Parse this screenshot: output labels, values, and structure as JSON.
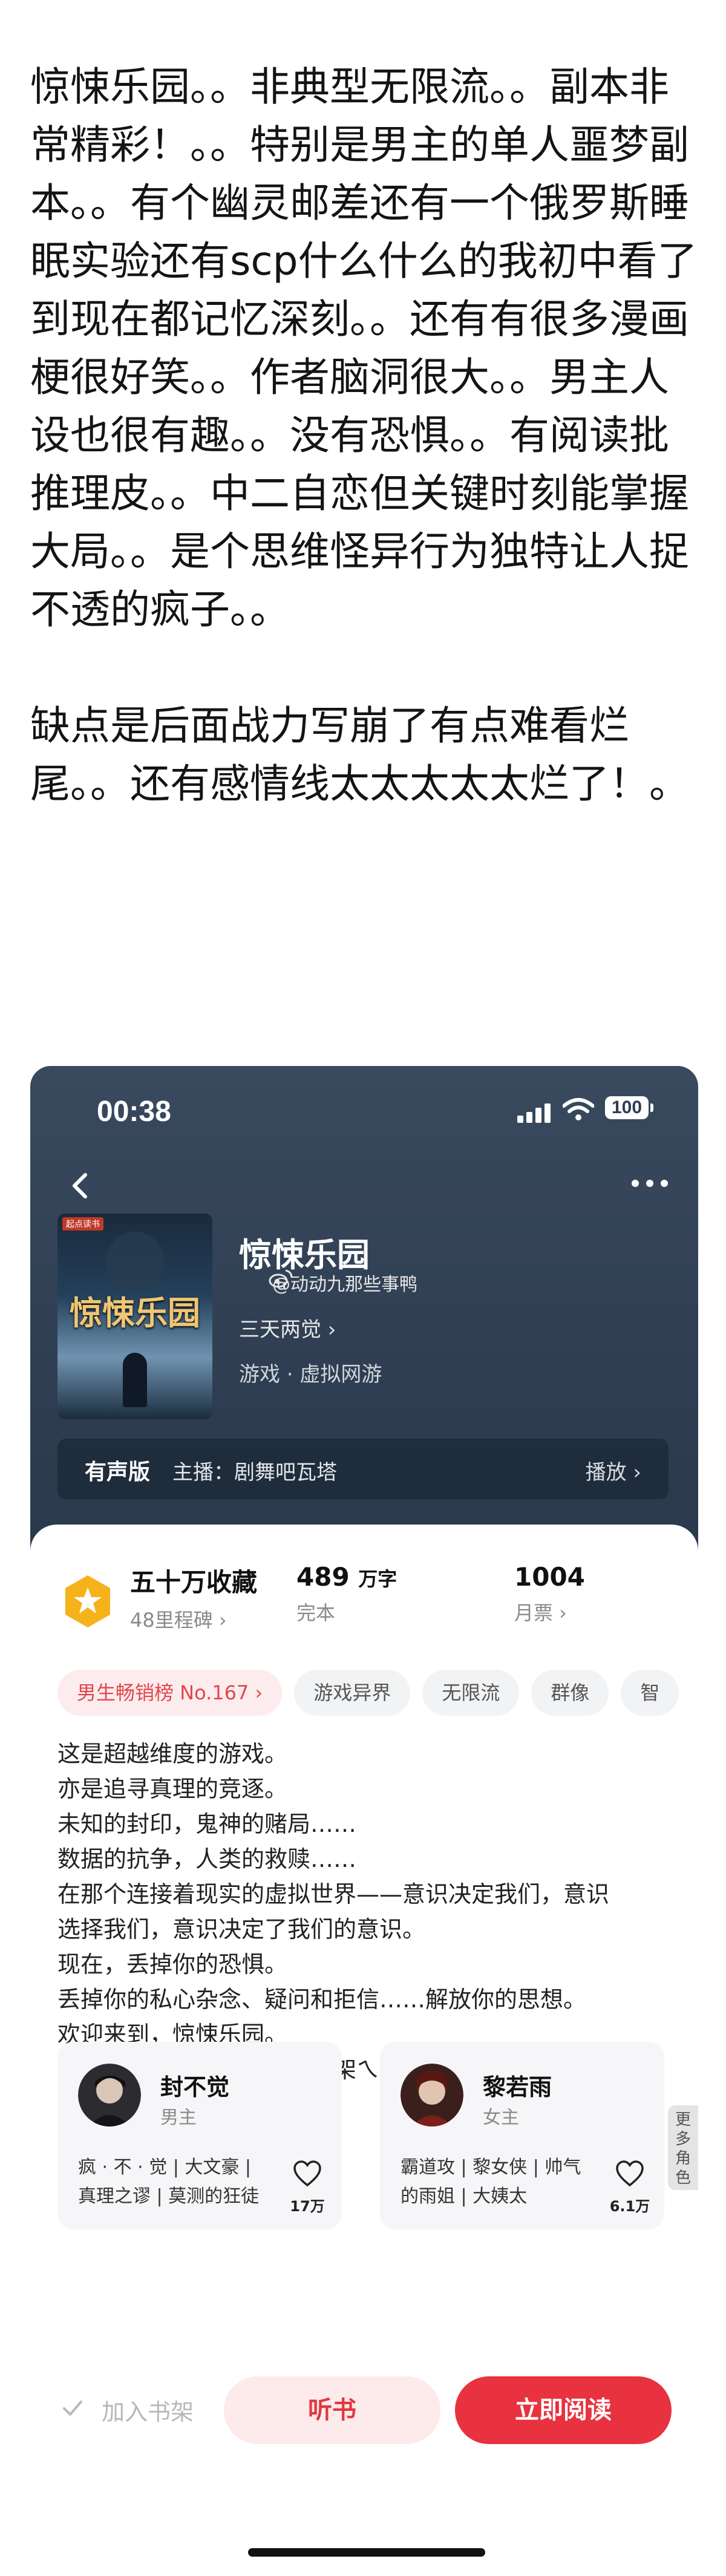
{
  "post": {
    "lines": [
      "惊悚乐园。。非典型无限流。。副本非",
      "常精彩！。。特别是男主的单人噩梦副",
      "本。。有个幽灵邮差还有一个俄罗斯睡",
      "眠实验还有scp什么什么的我初中看了",
      "到现在都记忆深刻。。还有有很多漫画",
      "梗很好笑。。作者脑洞很大。。男主人",
      "设也很有趣。。没有恐惧。。有阅读批",
      "推理皮。。中二自恋但关键时刻能掌握",
      "大局。。是个思维怪异行为独特让人捉",
      "不透的疯子。。"
    ],
    "lines2": [
      "缺点是后面战力写崩了有点难看烂",
      "尾。。还有感情线太太太太太烂了！。"
    ]
  },
  "status_bar": {
    "time": "00:38",
    "battery": "100"
  },
  "book": {
    "cover_tag": "起点读书",
    "cover_title": "惊悚乐园",
    "title": "惊悚乐园",
    "watermark": "@动动九那些事鸭",
    "author": "三天两觉 ›",
    "genre": "游戏 · 虚拟网游"
  },
  "audio": {
    "label": "有声版",
    "host": "主播：剧舞吧瓦塔",
    "play": "播放 ›"
  },
  "stats": {
    "collect_value": "五十万收藏",
    "collect_sub": "48里程碑 ›",
    "words_value": "489",
    "words_unit": "万字",
    "words_sub": "完本",
    "tickets_value": "1004",
    "tickets_sub": "月票 ›"
  },
  "tags": [
    "男生畅销榜 No.167 ›",
    "游戏异界",
    "无限流",
    "群像",
    "智"
  ],
  "intro": [
    "这是超越维度的游戏。",
    "亦是追寻真理的竞逐。",
    "未知的封印，鬼神的赌局……",
    "数据的抗争，人类的救赎……",
    "在那个连接着现实的虚拟世界——意识决定我们，意识",
    "选择我们，意识决定了我们的意识。",
    "现在，丢掉你的恐惧。",
    "丢掉你的私心杂念、疑问和拒信……解放你的思想。",
    "欢迎来到，惊悚乐园。",
    "《惊悚乐园》实体书现已上架ㄟ(￣▽￣)ㄏ"
  ],
  "characters": [
    {
      "name": "封不觉",
      "role": "男主",
      "desc1": "疯 · 不 · 觉 | 大文豪 |",
      "desc2": "真理之谬 | 莫测的狂徒",
      "likes": "17万"
    },
    {
      "name": "黎若雨",
      "role": "女主",
      "desc1": "霸道攻 | 黎女侠 | 帅气",
      "desc2": "的雨姐 | 大姨太",
      "likes": "6.1万"
    }
  ],
  "more_roles": [
    "更",
    "多",
    "角",
    "色"
  ],
  "actions": {
    "shelf": "加入书架",
    "listen": "听书",
    "read": "立即阅读"
  },
  "colors": {
    "accent": "#e8323f",
    "header_bg": "#2f3e52",
    "tag_bg": "#f2f3f5"
  }
}
